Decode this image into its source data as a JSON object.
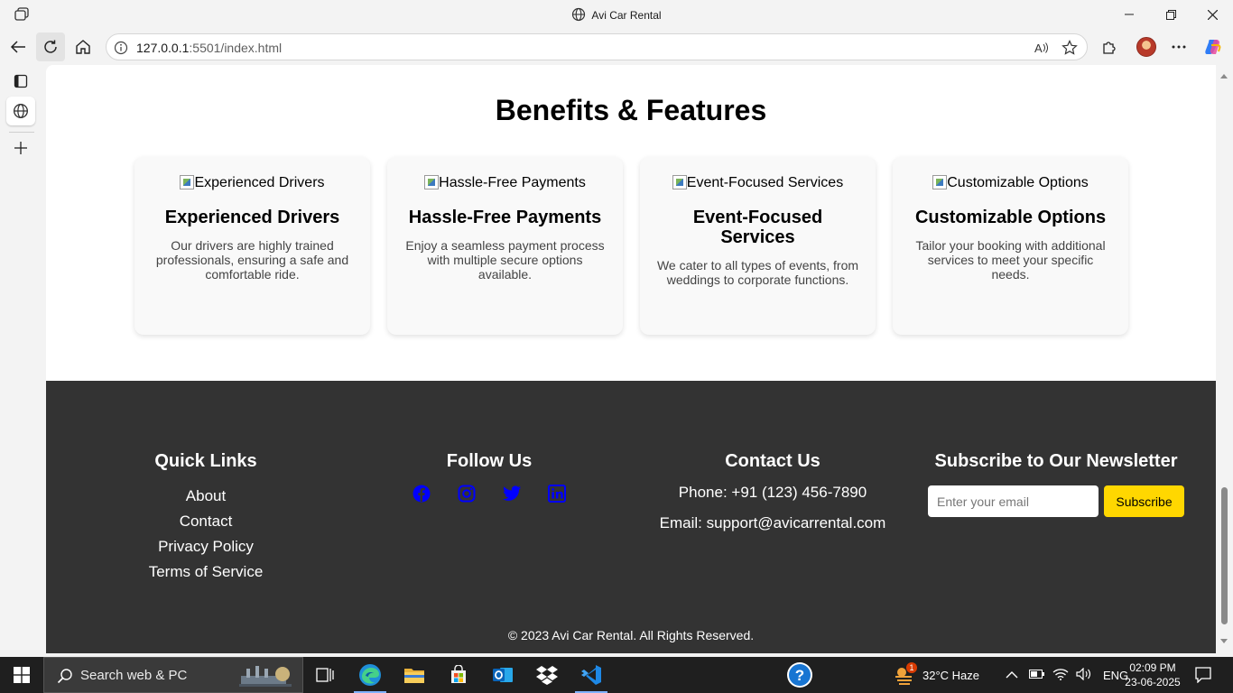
{
  "browser": {
    "window_title": "Avi Car Rental",
    "url_host": "127.0.0.1",
    "url_rest": ":5501/index.html"
  },
  "features": {
    "title": "Benefits & Features",
    "cards": [
      {
        "img_alt": "Experienced Drivers",
        "heading": "Experienced Drivers",
        "text": "Our drivers are highly trained professionals, ensuring a safe and comfortable ride."
      },
      {
        "img_alt": "Hassle-Free Payments",
        "heading": "Hassle-Free Payments",
        "text": "Enjoy a seamless payment process with multiple secure options available."
      },
      {
        "img_alt": "Event-Focused Services",
        "heading": "Event-Focused Services",
        "text": "We cater to all types of events, from weddings to corporate functions."
      },
      {
        "img_alt": "Customizable Options",
        "heading": "Customizable Options",
        "text": "Tailor your booking with additional services to meet your specific needs."
      }
    ]
  },
  "footer": {
    "quick_links": {
      "title": "Quick Links",
      "items": [
        "About",
        "Contact",
        "Privacy Policy",
        "Terms of Service"
      ]
    },
    "follow": {
      "title": "Follow Us",
      "icons": [
        "facebook-icon",
        "instagram-icon",
        "twitter-icon",
        "linkedin-icon"
      ]
    },
    "contact": {
      "title": "Contact Us",
      "phone": "Phone: +91 (123) 456-7890",
      "email": "Email: support@avicarrental.com"
    },
    "newsletter": {
      "title": "Subscribe to Our Newsletter",
      "placeholder": "Enter your email",
      "button": "Subscribe"
    },
    "copyright": "© 2023 Avi Car Rental. All Rights Reserved.",
    "social_icon_color": "#0000ff",
    "subscribe_color": "#ffd700",
    "background": "#333333"
  },
  "taskbar": {
    "search_placeholder": "Search web & PC",
    "weather": "32°C  Haze",
    "weather_badge": "1",
    "language": "ENG",
    "time": "02:09 PM",
    "date": "23-06-2025"
  }
}
